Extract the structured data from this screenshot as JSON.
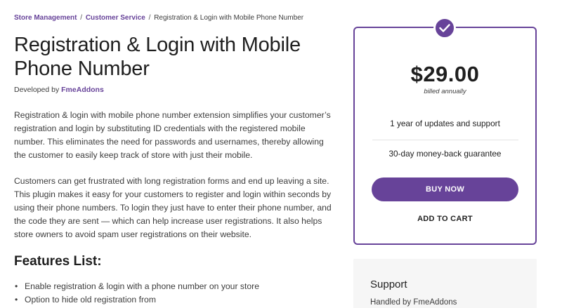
{
  "breadcrumb": {
    "items": [
      "Store Management",
      "Customer Service",
      "Registration & Login with Mobile Phone Number"
    ],
    "separator": "/"
  },
  "product": {
    "title": "Registration & Login with Mobile Phone Number",
    "developed_by_label": "Developed by",
    "developer": "FmeAddons"
  },
  "description": {
    "paragraph_1": "Registration & login with mobile phone number extension simplifies your customer’s registration and login by substituting ID credentials with the registered mobile number. This eliminates the need for passwords and usernames, thereby allowing the customer to easily keep track of store with just their mobile.",
    "paragraph_2": "Customers can get frustrated with long registration forms and end up leaving a site. This plugin makes it easy for your customers to register and login within seconds by using their phone numbers. To login they just have to enter their phone number, and the code they are sent — which can help increase user registrations. It also helps store owners to avoid spam user registrations on their website."
  },
  "features": {
    "heading": "Features List:",
    "items": [
      "Enable registration & login with a phone number on your store",
      "Option to hide old registration from"
    ]
  },
  "pricing": {
    "badge_icon": "check-icon",
    "price": "$29.00",
    "billing": "billed annually",
    "benefit_1": "1 year of updates and support",
    "benefit_2": "30-day money-back guarantee",
    "buy_now_label": "BUY NOW",
    "add_to_cart_label": "ADD TO CART"
  },
  "support": {
    "title": "Support",
    "handled_by": "Handled by FmeAddons"
  },
  "colors": {
    "accent": "#674399",
    "text": "#1e1e1e",
    "support_bg": "#f6f6f6"
  }
}
